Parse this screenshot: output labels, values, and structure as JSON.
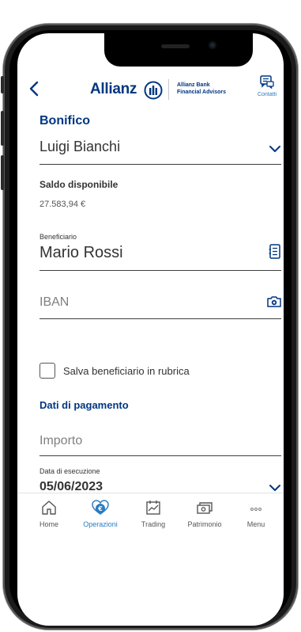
{
  "header": {
    "brand_name": "Allianz",
    "brand_sub_line1": "Allianz Bank",
    "brand_sub_line2": "Financial Advisors",
    "contacts_label": "Contatti",
    "back_icon": "chevron-left-icon",
    "contacts_icon": "chat-icon"
  },
  "form": {
    "title": "Bonifico",
    "account": "Luigi Bianchi",
    "balance_label": "Saldo disponibile",
    "balance_value": "27.583,94 €",
    "beneficiary_label": "Beneficiario",
    "beneficiary_value": "Mario Rossi",
    "iban_placeholder": "IBAN",
    "save_beneficiary_label": "Salva beneficiario in rubrica",
    "save_beneficiary_checked": false,
    "payment_section_title": "Dati di pagamento",
    "amount_placeholder": "Importo",
    "execution_date_label": "Data di esecuzione",
    "execution_date_value": "05/06/2023"
  },
  "tabbar": {
    "items": [
      {
        "label": "Home",
        "icon": "home-icon",
        "active": false
      },
      {
        "label": "Operazioni",
        "icon": "euro-transfer-icon",
        "active": true
      },
      {
        "label": "Trading",
        "icon": "chart-icon",
        "active": false
      },
      {
        "label": "Patrimonio",
        "icon": "wallet-icon",
        "active": false
      },
      {
        "label": "Menu",
        "icon": "more-icon",
        "active": false
      }
    ]
  },
  "colors": {
    "brand_blue": "#003781",
    "accent_blue": "#2a7bc2",
    "text": "#333333",
    "placeholder": "#808080"
  }
}
